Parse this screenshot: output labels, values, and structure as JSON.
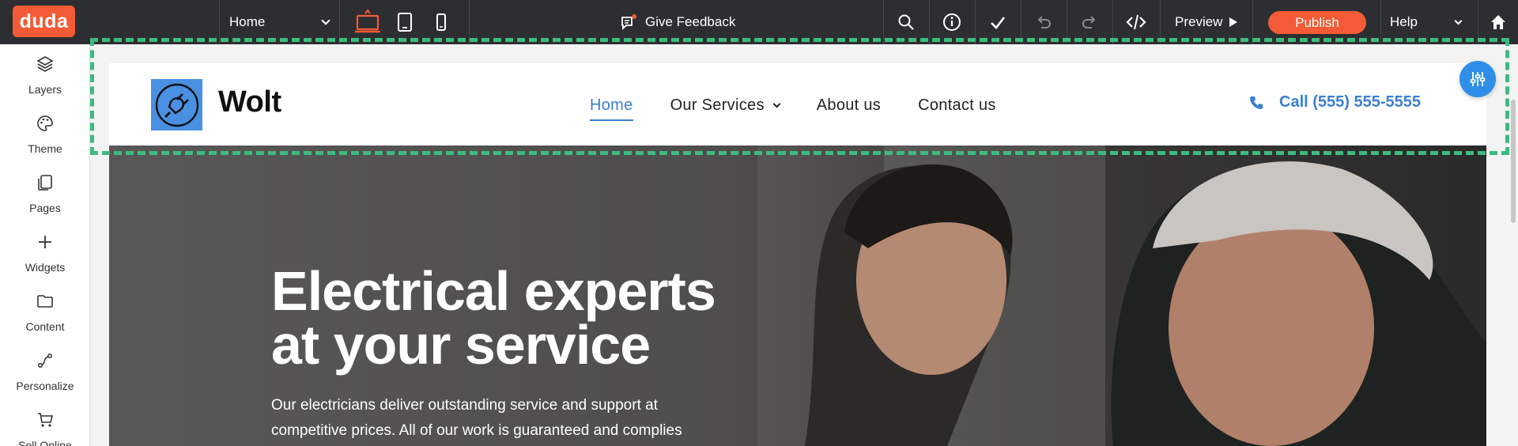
{
  "toolbar": {
    "logo_text": "duda",
    "page_select_value": "Home",
    "devices": [
      "desktop-icon",
      "tablet-icon",
      "mobile-icon"
    ],
    "feedback_label": "Give Feedback",
    "preview_label": "Preview",
    "publish_label": "Publish",
    "help_label": "Help",
    "accent_color": "#f25b35"
  },
  "sidebar": {
    "items": [
      {
        "label": "Layers",
        "icon": "layers-icon"
      },
      {
        "label": "Theme",
        "icon": "palette-icon"
      },
      {
        "label": "Pages",
        "icon": "pages-icon"
      },
      {
        "label": "Widgets",
        "icon": "plus-icon"
      },
      {
        "label": "Content",
        "icon": "folder-icon"
      },
      {
        "label": "Personalize",
        "icon": "personalize-icon"
      },
      {
        "label": "Sell Online",
        "icon": "cart-icon"
      }
    ]
  },
  "site": {
    "brand_name": "Wolt",
    "nav": [
      {
        "label": "Home",
        "active": true
      },
      {
        "label": "Our Services",
        "has_dropdown": true
      },
      {
        "label": "About us"
      },
      {
        "label": "Contact us"
      }
    ],
    "phone_label": "Call (555) 555-5555",
    "link_color": "#3c7fd0",
    "hero_title_line1": "Electrical experts",
    "hero_title_line2": "at your service",
    "hero_sub_line1": "Our electricians deliver outstanding service and support at",
    "hero_sub_line2": "competitive prices. All of our work is guaranteed and complies"
  },
  "selection_color": "#3dbb7f"
}
